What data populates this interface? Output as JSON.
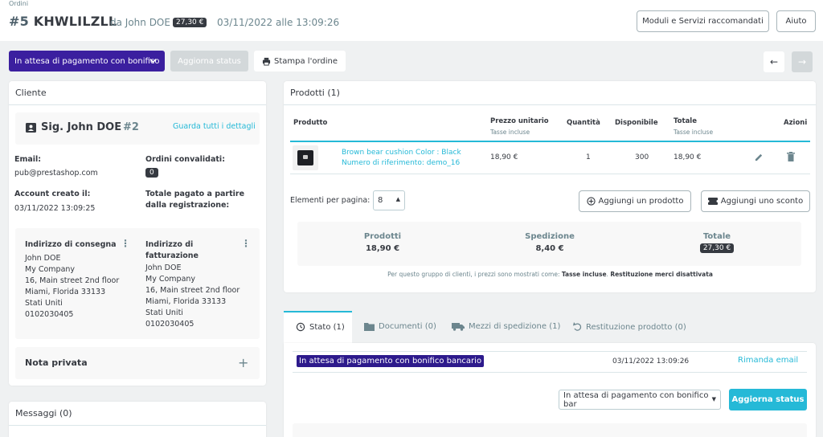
{
  "header": {
    "breadcrumb": "Ordini",
    "order_number": "#5",
    "order_ref": "KHWLILZLL",
    "from_label": "da John DOE",
    "total_badge": "27,30 €",
    "date": "03/11/2022 alle 13:09:26",
    "modules_button": "Moduli e Servizi raccomandati",
    "help_button": "Aiuto"
  },
  "toolbar": {
    "status_select": "In attesa di pagamento con bonifico",
    "update_status": "Aggiorna status",
    "print_order": "Stampa l'ordine",
    "prev_icon": "←",
    "next_icon": "→"
  },
  "customer": {
    "title": "Cliente",
    "name": "Sig. John DOE",
    "id": "#2",
    "details_link": "Guarda tutti i dettagli",
    "email_label": "Email:",
    "email": "pub@prestashop.com",
    "validated_label": "Ordini convalidati:",
    "validated_count": "0",
    "created_label": "Account creato il:",
    "created_value": "03/11/2022 13:09:25",
    "total_paid_label": "Totale pagato a partire dalla registrazione:",
    "shipping_title": "Indirizzo di consegna",
    "shipping_lines": [
      "John DOE",
      "My Company",
      "16, Main street 2nd floor",
      "Miami, Florida 33133",
      "Stati Uniti",
      "0102030405"
    ],
    "billing_title": "Indirizzo di fatturazione",
    "billing_lines": [
      "John DOE",
      "My Company",
      "16, Main street 2nd floor",
      "Miami, Florida 33133",
      "Stati Uniti",
      "0102030405"
    ],
    "private_note": "Nota privata",
    "add_icon": "+"
  },
  "messages": {
    "title": "Messaggi (0)"
  },
  "products": {
    "title": "Prodotti (1)",
    "columns": {
      "product": "Produtto",
      "unit_price": "Prezzo unitario",
      "unit_price_sub": "Tasse incluse",
      "quantity": "Quantità",
      "available": "Disponibile",
      "total": "Totale",
      "total_sub": "Tasse incluse",
      "actions": "Azioni"
    },
    "row": {
      "name": "Brown bear cushion Color : Black",
      "ref": "Numero di riferimento: demo_16",
      "unit_price": "18,90 €",
      "quantity": "1",
      "available": "300",
      "total": "18,90 €"
    },
    "per_page_label": "Elementi per pagina:",
    "per_page_value": "8",
    "add_product": "Aggiungi un prodotto",
    "add_discount": "Aggiungi uno sconto",
    "summary": {
      "products_label": "Prodotti",
      "products_value": "18,90 €",
      "shipping_label": "Spedizione",
      "shipping_value": "8,40 €",
      "total_label": "Totale",
      "total_value": "27,30 €"
    },
    "note_prefix": "Per questo gruppo di clienti, i prezzi sono mostrati come: ",
    "note_taxes": "Tasse incluse",
    "note_mid": ". ",
    "note_returns": "Restituzione merci disattivata"
  },
  "tabs": {
    "status": "Stato (1)",
    "documents": "Documenti (0)",
    "carriers": "Mezzi di spedizione (1)",
    "returns": "Restituzione prodotto (0)"
  },
  "history": {
    "status": "In attesa di pagamento con bonifico bancario",
    "date": "03/11/2022 13:09:26",
    "resend": "Rimanda email",
    "select_value": "In attesa di pagamento con bonifico bar",
    "update_button": "Aggiorna status"
  },
  "colors": {
    "accent": "#25b9d7",
    "status_purple": "#3b1f9f",
    "dark_badge": "#363a41"
  }
}
